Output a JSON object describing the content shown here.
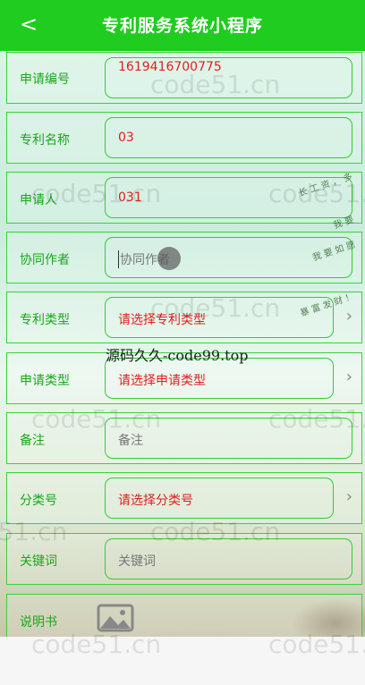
{
  "header": {
    "title": "专利服务系统小程序",
    "back": "<"
  },
  "form": {
    "apply_no": {
      "label": "申请编号",
      "value": "1619416700775"
    },
    "patent_name": {
      "label": "专利名称",
      "value": "03"
    },
    "applicant": {
      "label": "申请人",
      "value": "031"
    },
    "co_author": {
      "label": "协同作者",
      "placeholder": "协同作者"
    },
    "patent_type": {
      "label": "专利类型",
      "value": "请选择专利类型"
    },
    "apply_type": {
      "label": "申请类型",
      "value": "请选择申请类型"
    },
    "remark": {
      "label": "备注",
      "placeholder": "备注"
    },
    "class_no": {
      "label": "分类号",
      "value": "请选择分类号"
    },
    "keywords": {
      "label": "关键词",
      "placeholder": "关键词"
    },
    "description": {
      "label": "说明书"
    }
  },
  "watermarks": {
    "code51": "code51.cn",
    "code99": "源码久久-code99.top"
  },
  "icons": [
    "chevron-left-icon",
    "chevron-right-icon",
    "image-placeholder-icon"
  ]
}
